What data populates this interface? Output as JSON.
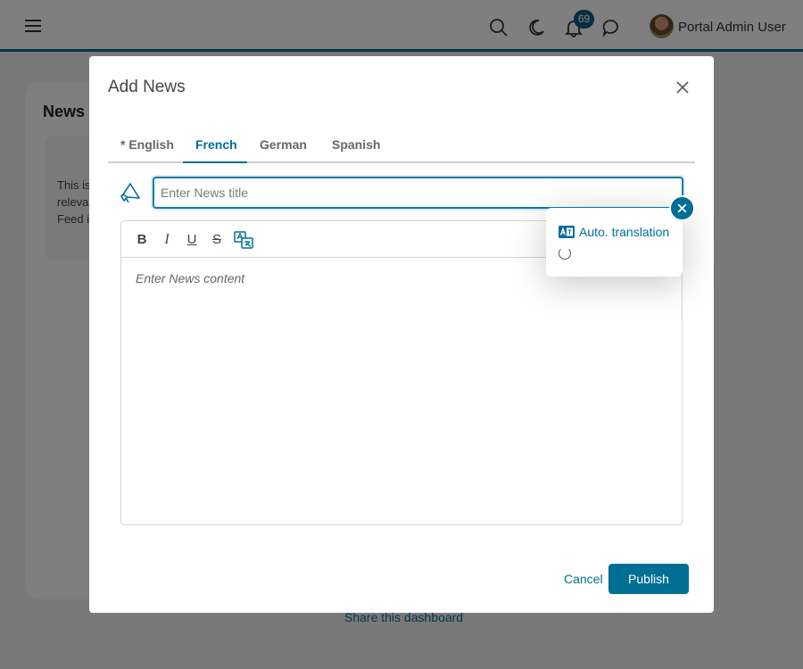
{
  "topbar": {
    "notification_count": "69",
    "user_name": "Portal Admin User"
  },
  "background": {
    "card_title": "News f",
    "inner_lines": [
      "This is",
      "releva",
      "Feed i"
    ],
    "share_link": "Share this dashboard"
  },
  "modal": {
    "title": "Add News",
    "tabs": [
      {
        "label": "* English"
      },
      {
        "label": "French",
        "active": true
      },
      {
        "label": "German"
      },
      {
        "label": "Spanish"
      }
    ],
    "title_placeholder": "Enter News title",
    "content_placeholder": "Enter News content",
    "cancel_label": "Cancel",
    "publish_label": "Publish"
  },
  "popover": {
    "option_label": "Auto. translation"
  },
  "colors": {
    "accent": "#006f94"
  }
}
